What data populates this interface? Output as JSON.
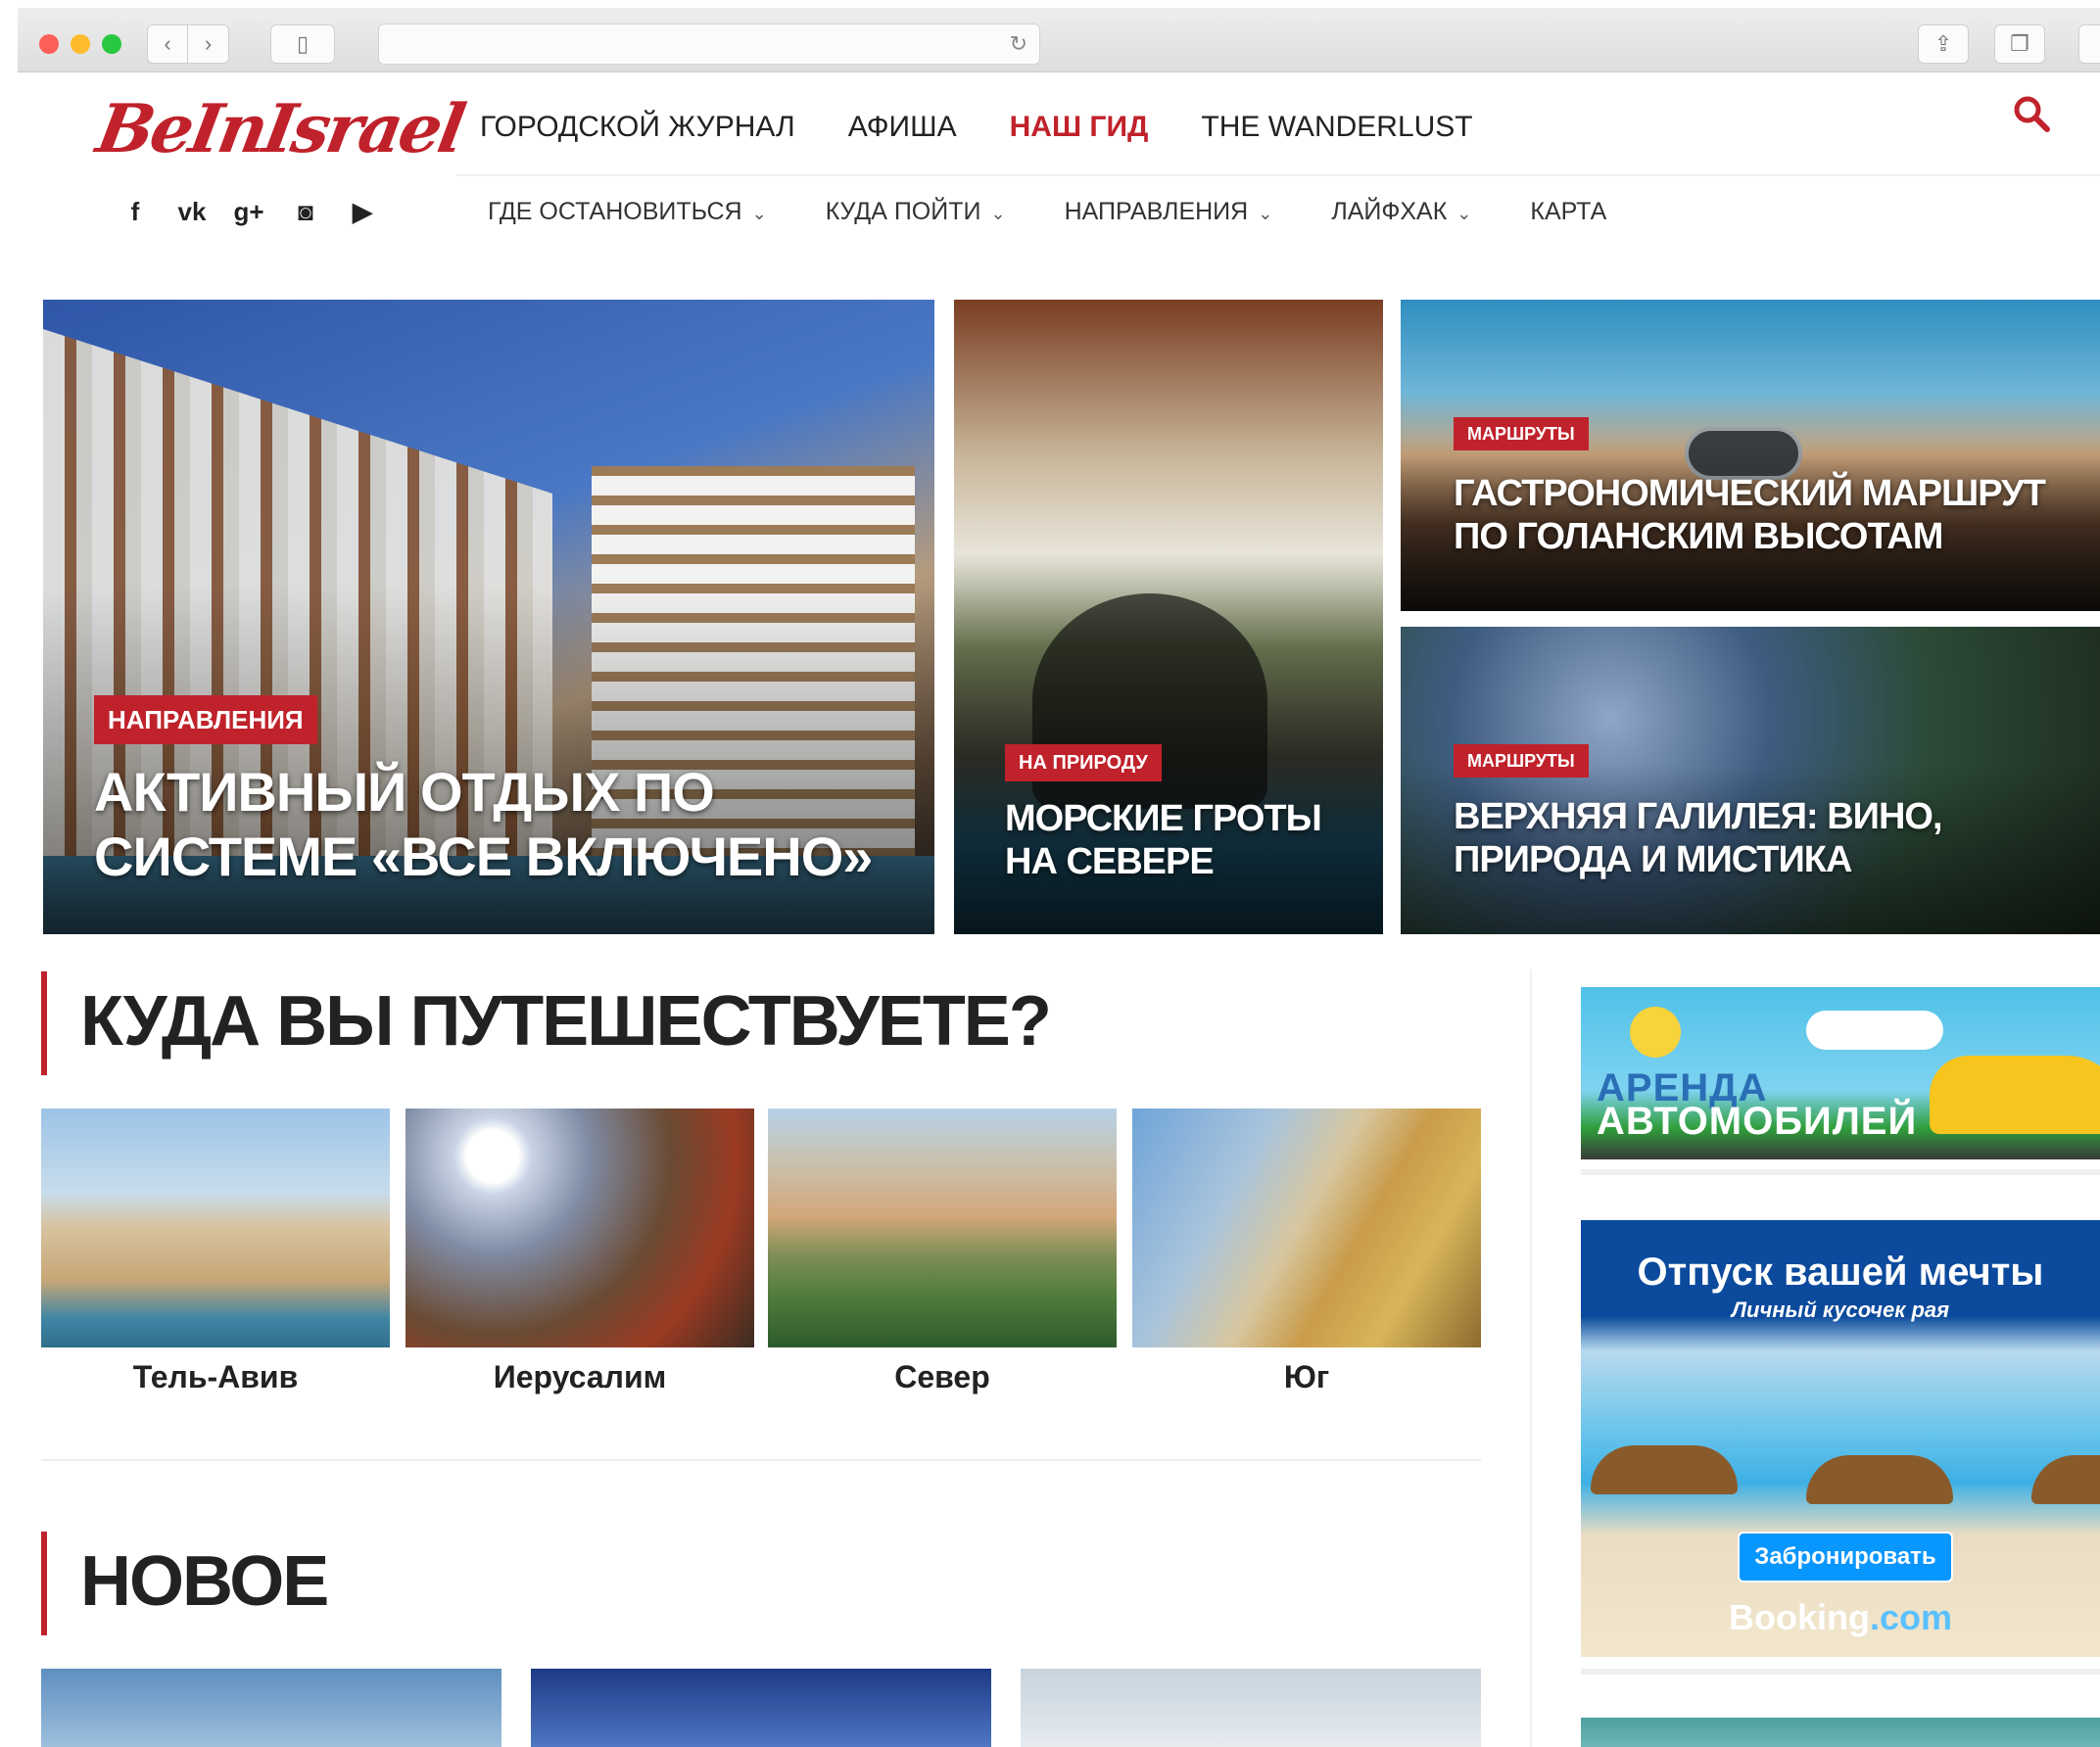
{
  "site": {
    "logo": "BeInIsrael",
    "top_nav": [
      {
        "label": "ГОРОДСКОЙ ЖУРНАЛ"
      },
      {
        "label": "АФИША"
      },
      {
        "label": "НАШ ГИД"
      },
      {
        "label": "THE WANDERLUST"
      }
    ],
    "active_top_nav": "НАШ ГИД",
    "sub_nav": [
      {
        "label": "ГДЕ ОСТАНОВИТЬСЯ"
      },
      {
        "label": "КУДА ПОЙТИ"
      },
      {
        "label": "НАПРАВЛЕНИЯ"
      },
      {
        "label": "ЛАЙФХАК"
      },
      {
        "label": "КАРТА"
      }
    ],
    "social": [
      "facebook-icon",
      "vk-icon",
      "google-plus-icon",
      "instagram-icon",
      "youtube-icon"
    ],
    "social_glyphs": [
      "f",
      "vk",
      "g+",
      "◙",
      "▶"
    ]
  },
  "hero": [
    {
      "tag": "НАПРАВЛЕНИЯ",
      "title": "АКТИВНЫЙ ОТДЫХ ПО СИСТЕМЕ «ВСЕ ВКЛЮЧЕНО»"
    },
    {
      "tag": "НА ПРИРОДУ",
      "title": "МОРСКИЕ ГРОТЫ НА СЕВЕРЕ"
    },
    {
      "tag": "МАРШРУТЫ",
      "title": "ГАСТРОНОМИЧЕСКИЙ МАРШРУТ ПО ГОЛАНСКИМ ВЫСОТАМ"
    },
    {
      "tag": "МАРШРУТЫ",
      "title": "ВЕРХНЯЯ ГАЛИЛЕЯ: ВИНО, ПРИРОДА И МИСТИКА"
    }
  ],
  "sections": {
    "where": "КУДА ВЫ ПУТЕШЕСТВУЕТЕ?",
    "new": "НОВОЕ"
  },
  "cities": [
    {
      "name": "Тель-Авив"
    },
    {
      "name": "Иерусалим"
    },
    {
      "name": "Север"
    },
    {
      "name": "Юг"
    }
  ],
  "ads": {
    "car": {
      "line1": "АРЕНДА",
      "line2": "АВТОМОБИЛЕЙ"
    },
    "booking": {
      "title": "Отпуск вашей мечты",
      "subtitle": "Личный кусочек рая",
      "button": "Забронировать",
      "brand_a": "Booking",
      "brand_b": ".com"
    }
  },
  "colors": {
    "accent": "#c0222b"
  }
}
